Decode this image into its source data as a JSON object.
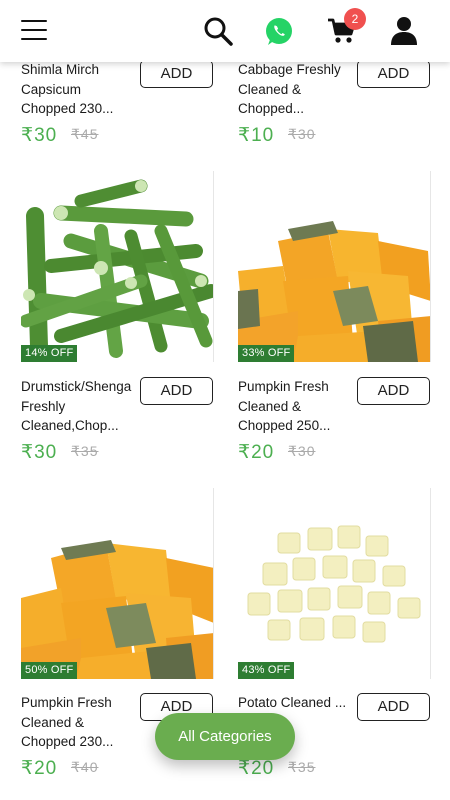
{
  "header": {
    "menu_icon": "hamburger-menu-icon",
    "search_icon": "search-icon",
    "whatsapp_icon": "whatsapp-icon",
    "cart_icon": "cart-icon",
    "cart_count": "2",
    "user_icon": "user-icon",
    "whatsapp_color": "#25D366",
    "badge_color": "#f0504f"
  },
  "products": [
    {
      "name": "Shimla Mirch Capsicum Chopped 230...",
      "price": "₹30",
      "mrp": "₹45",
      "add_label": "ADD"
    },
    {
      "name": "Cabbage Freshly Cleaned & Chopped...",
      "price": "₹10",
      "mrp": "₹30",
      "add_label": "ADD"
    },
    {
      "name": "Drumstick/Shenga Freshly Cleaned,Chop...",
      "price": "₹30",
      "mrp": "₹35",
      "add_label": "ADD",
      "discount": "14% OFF",
      "image": "drumstick"
    },
    {
      "name": "Pumpkin Fresh Cleaned & Chopped 250...",
      "price": "₹20",
      "mrp": "₹30",
      "add_label": "ADD",
      "discount": "33% OFF",
      "image": "pumpkin"
    },
    {
      "name": "Pumpkin Fresh Cleaned & Chopped 230...",
      "price": "₹20",
      "mrp": "₹40",
      "add_label": "ADD",
      "discount": "50% OFF",
      "image": "pumpkin"
    },
    {
      "name": "Potato Cleaned ... 250",
      "price": "₹20",
      "mrp": "₹35",
      "add_label": "ADD",
      "discount": "43% OFF",
      "image": "potato"
    }
  ],
  "all_categories_label": "All Categories",
  "colors": {
    "price_green": "#4caf50",
    "discount_green": "#2e7d32",
    "fab_green": "#6aad4f"
  }
}
